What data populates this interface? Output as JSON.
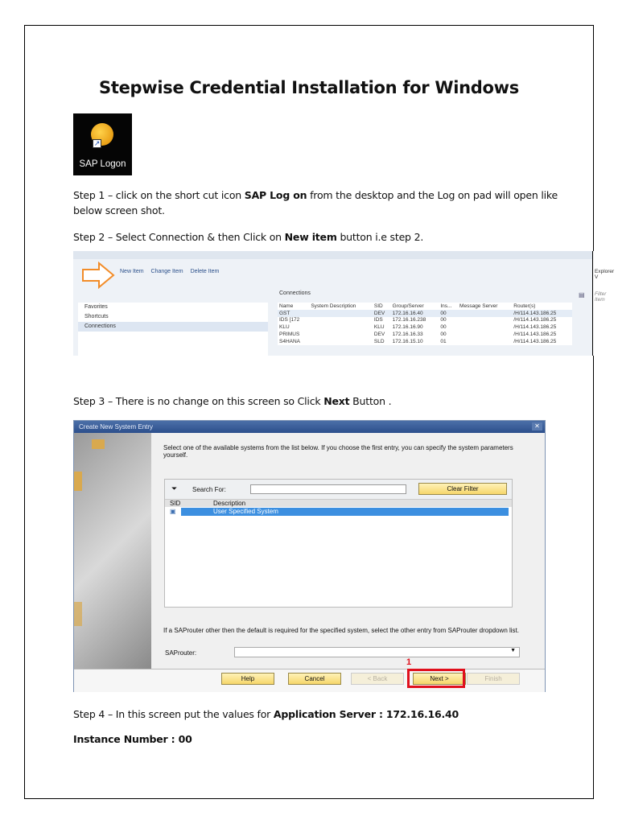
{
  "title": "Stepwise Credential Installation for Windows",
  "logo": {
    "label": "SAP Logon"
  },
  "step1": {
    "prefix": "Step 1 – click on the short cut icon ",
    "bold": "SAP Log on",
    "suffix": " from the desktop and the Log on pad will open like below screen shot."
  },
  "step2": {
    "prefix": "Step 2 – Select Connection & then Click on ",
    "bold": "New item",
    "suffix": " button i.e step 2."
  },
  "step3": {
    "prefix": "Step 3 – There is no change on this screen so Click ",
    "bold": "Next",
    "suffix": " Button ."
  },
  "step4": {
    "prefix": "Step 4 – In this screen put the values for ",
    "bold": "Application Server : 172.16.16.40"
  },
  "instance": "Instance Number : 00",
  "logon": {
    "toolbar": [
      "New Item",
      "Change Item",
      "Delete Item"
    ],
    "sidebar": [
      "Favorites",
      "Shortcuts",
      "Connections"
    ],
    "connections_label": "Connections",
    "explorer": "Explorer V",
    "filter_placeholder": "Filter Item",
    "columns": [
      "Name",
      "System Description",
      "SID",
      "Group/Server",
      "Ins...",
      "Message Server",
      "Router(s)"
    ],
    "rows": [
      [
        "GST",
        "",
        "DEV",
        "172.16.16.40",
        "00",
        "",
        "/H/114.143.186.25"
      ],
      [
        "IDS [172",
        "",
        "IDS",
        "172.16.16.238",
        "00",
        "",
        "/H/114.143.186.25"
      ],
      [
        "KLU",
        "",
        "KLU",
        "172.16.16.90",
        "00",
        "",
        "/H/114.143.186.25"
      ],
      [
        "PRIMUS",
        "",
        "DEV",
        "172.16.16.33",
        "00",
        "",
        "/H/114.143.186.25"
      ],
      [
        "S4HANA",
        "",
        "SLD",
        "172.16.15.10",
        "01",
        "",
        "/H/114.143.186.25"
      ]
    ]
  },
  "dialog": {
    "title": "Create New System Entry",
    "instructions": "Select one of the available systems from the list below. If you choose the first entry, you can specify the system parameters yourself.",
    "search_label": "Search For:",
    "clear_filter": "Clear Filter",
    "col_sid": "SID",
    "col_desc": "Description",
    "row": "User Specified System",
    "router_note": "If a SAProuter other then the default is required for the specified system, select the other entry from SAProuter dropdown list.",
    "router_label": "SAProuter:",
    "buttons": {
      "help": "Help",
      "cancel": "Cancel",
      "back": "< Back",
      "next": "Next >",
      "finish": "Finish"
    },
    "marker": "1"
  }
}
